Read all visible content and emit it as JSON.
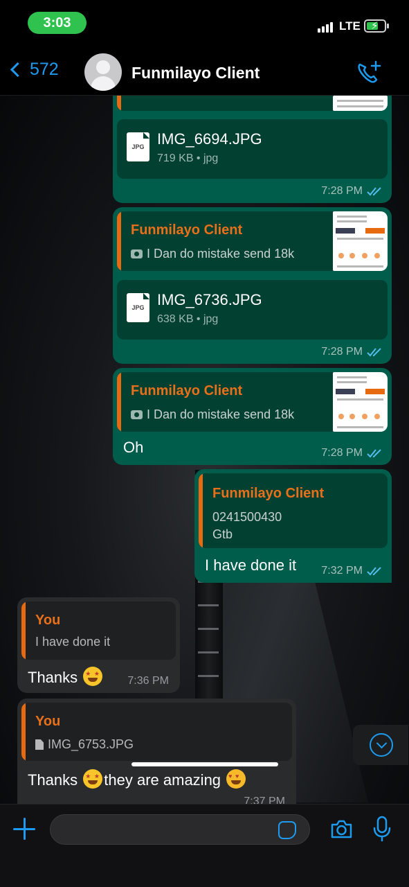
{
  "status_bar": {
    "time": "3:03",
    "network": "LTE"
  },
  "header": {
    "back_count": "572",
    "contact_name": "Funmilayo Client"
  },
  "messages": [
    {
      "type": "file",
      "direction": "out",
      "file_name": "IMG_6694.JPG",
      "file_meta": "719 KB • jpg",
      "file_icon": "JPG",
      "time": "7:28 PM"
    },
    {
      "type": "file",
      "direction": "out",
      "quote_name": "Funmilayo Client",
      "quote_text": "I Dan do mistake send 18k",
      "file_name": "IMG_6736.JPG",
      "file_meta": "638 KB • jpg",
      "file_icon": "JPG",
      "time": "7:28 PM"
    },
    {
      "type": "text",
      "direction": "out",
      "quote_name": "Funmilayo Client",
      "quote_text": "I Dan do mistake send 18k",
      "text": "Oh",
      "time": "7:28 PM"
    },
    {
      "type": "text",
      "direction": "out",
      "quote_name": "Funmilayo Client",
      "quote_line1": "0241500430",
      "quote_line2": "Gtb",
      "text": "I have done it",
      "time": "7:32 PM"
    },
    {
      "type": "text",
      "direction": "in",
      "quote_name": "You",
      "quote_text": "I have done it",
      "text": "Thanks",
      "time": "7:36 PM"
    },
    {
      "type": "text",
      "direction": "in",
      "quote_name": "You",
      "quote_text": "IMG_6753.JPG",
      "text_before": "Thanks",
      "text_after": "they are amazing",
      "time": "7:37 PM"
    }
  ],
  "composer": {
    "placeholder": ""
  },
  "colors": {
    "accent": "#1d9bf0",
    "outgoing_bubble": "#005c4b",
    "incoming_bubble": "#2a2b2d",
    "quote_name": "#e8701a"
  }
}
